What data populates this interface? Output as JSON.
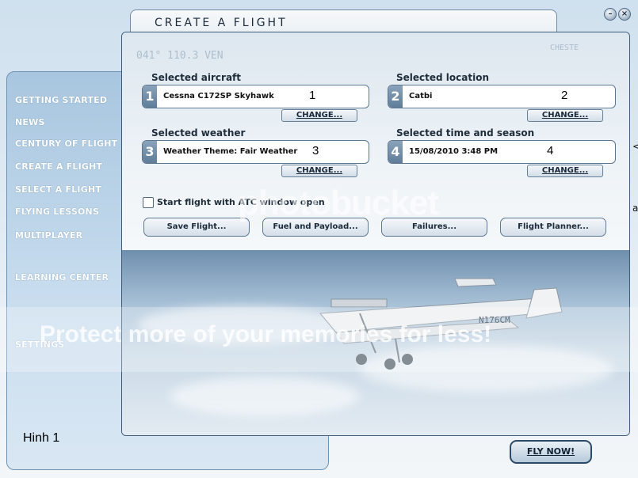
{
  "window": {
    "title": "CREATE A FLIGHT",
    "minimize": "–",
    "close": "×"
  },
  "sidebar": {
    "items": [
      {
        "label": "GETTING STARTED"
      },
      {
        "label": "NEWS"
      },
      {
        "label": "CENTURY OF FLIGHT"
      },
      {
        "label": "CREATE A FLIGHT"
      },
      {
        "label": "SELECT A FLIGHT"
      },
      {
        "label": "FLYING LESSONS"
      },
      {
        "label": "MULTIPLAYER"
      },
      {
        "label": "LEARNING CENTER"
      },
      {
        "label": "SETTINGS"
      }
    ],
    "footer": "Hinh 1"
  },
  "sections": {
    "aircraft": {
      "label": "Selected aircraft",
      "number": "1",
      "value": "Cessna C172SP Skyhawk",
      "annotation": "1",
      "change": "CHANGE..."
    },
    "location": {
      "label": "Selected location",
      "number": "2",
      "value": "Catbi",
      "annotation": "2",
      "change": "CHANGE..."
    },
    "weather": {
      "label": "Selected weather",
      "number": "3",
      "value": "Weather Theme: Fair Weather",
      "annotation": "3",
      "change": "CHANGE..."
    },
    "time": {
      "label": "Selected time and season",
      "number": "4",
      "value": "15/08/2010 3:48 PM",
      "annotation": "4",
      "change": "CHANGE..."
    }
  },
  "atc_checkbox": {
    "label": "Start flight with ATC window open",
    "checked": false
  },
  "actions": {
    "save": "Save Flight...",
    "fuel": "Fuel and Payload...",
    "failures": "Failures...",
    "planner": "Flight Planner..."
  },
  "fly_now": "FLY NOW!",
  "deco": {
    "chart_a": "041° 110.3 VEN",
    "chart_b": "CHESTE",
    "tail": "N176CM"
  },
  "watermark": {
    "logo": "photobucket",
    "banner": "Protect more of your memories for less!"
  },
  "edge": {
    "glyph1": "<",
    "glyph2": "a"
  },
  "colors": {
    "accent": "#5f7d99",
    "sidebar": "#a8c6df",
    "border": "#3c5a78"
  }
}
